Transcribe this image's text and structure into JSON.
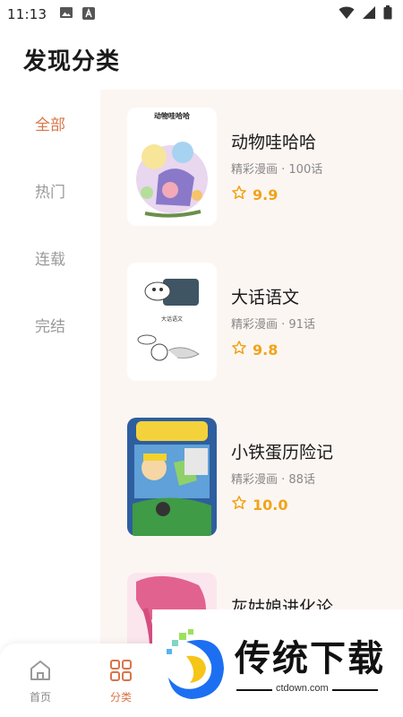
{
  "status_bar": {
    "time": "11:13"
  },
  "page": {
    "title": "发现分类"
  },
  "sidebar": {
    "items": [
      {
        "label": "全部",
        "active": true
      },
      {
        "label": "热门",
        "active": false
      },
      {
        "label": "连载",
        "active": false
      },
      {
        "label": "完结",
        "active": false
      }
    ]
  },
  "comics": [
    {
      "title": "动物哇哈哈",
      "meta": "精彩漫画 · 100话",
      "rating": "9.9",
      "cover_text": "动物哇哈哈"
    },
    {
      "title": "大话语文",
      "meta": "精彩漫画 · 91话",
      "rating": "9.8",
      "cover_text": "大话语文"
    },
    {
      "title": "小铁蛋历险记",
      "meta": "精彩漫画 · 88话",
      "rating": "10.0",
      "cover_text": ""
    },
    {
      "title": "灰姑娘进化论",
      "meta": "",
      "rating": "",
      "cover_text": ""
    }
  ],
  "bottom_nav": {
    "items": [
      {
        "label": "首页",
        "icon": "home-icon",
        "active": false
      },
      {
        "label": "分类",
        "icon": "grid-icon",
        "active": true
      }
    ]
  },
  "watermark": {
    "name": "传统下载",
    "domain": "ctdown.com"
  },
  "colors": {
    "accent": "#d8754a",
    "rating": "#f0a418",
    "panel_bg": "#fcf6f3"
  }
}
